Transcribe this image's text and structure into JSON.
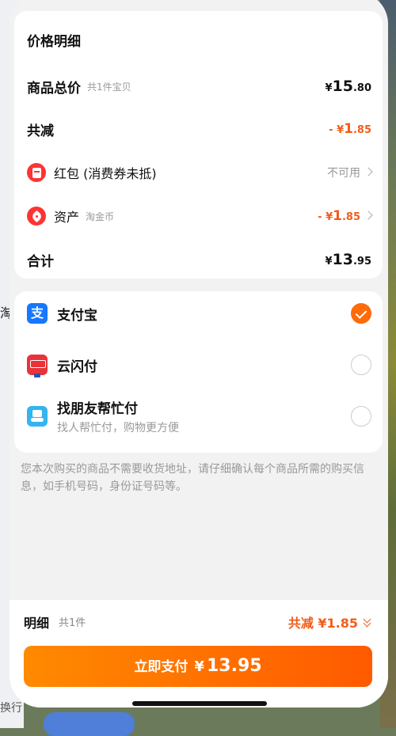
{
  "background": {
    "edge_text": "淘",
    "edge_bottom_text": "换行"
  },
  "price_details": {
    "title": "价格明细",
    "total": {
      "label": "商品总价",
      "sub": "共1件宝贝",
      "yen": "¥",
      "int": "15",
      "dec": ".80"
    },
    "reduce": {
      "label": "共减",
      "prefix": "- ¥",
      "int": "1",
      "dec": ".85"
    },
    "red_packet": {
      "label": "红包 (消费券未抵)",
      "value": "不可用",
      "icon": "red-packet-icon"
    },
    "assets": {
      "label": "资产",
      "sub": "淘金币",
      "prefix": "- ¥",
      "int": "1",
      "dec": ".85",
      "icon": "tag-icon"
    },
    "sum": {
      "label": "合计",
      "yen": "¥",
      "int": "13",
      "dec": ".95"
    }
  },
  "payment_methods": [
    {
      "name": "支付宝",
      "icon": "alipay-icon",
      "icon_text": "支",
      "selected": true
    },
    {
      "name": "云闪付",
      "icon": "unionpay-icon",
      "selected": false
    },
    {
      "name": "找朋友帮忙付",
      "desc": "找人帮忙付，购物更方便",
      "icon": "friend-pay-icon",
      "selected": false
    }
  ],
  "notice": "您本次购买的商品不需要收货地址，请仔细确认每个商品所需的购买信息，如手机号码，身份证号码等。",
  "bottom_bar": {
    "detail_label": "明细",
    "detail_count": "共1件",
    "reduce_text": "共减 ¥1.85",
    "pay_button": {
      "label": "立即支付",
      "yen": "¥",
      "amount": "13.95"
    }
  },
  "colors": {
    "accent": "#ff6a0a",
    "discount": "#f25c19",
    "alipay": "#1677ff"
  }
}
